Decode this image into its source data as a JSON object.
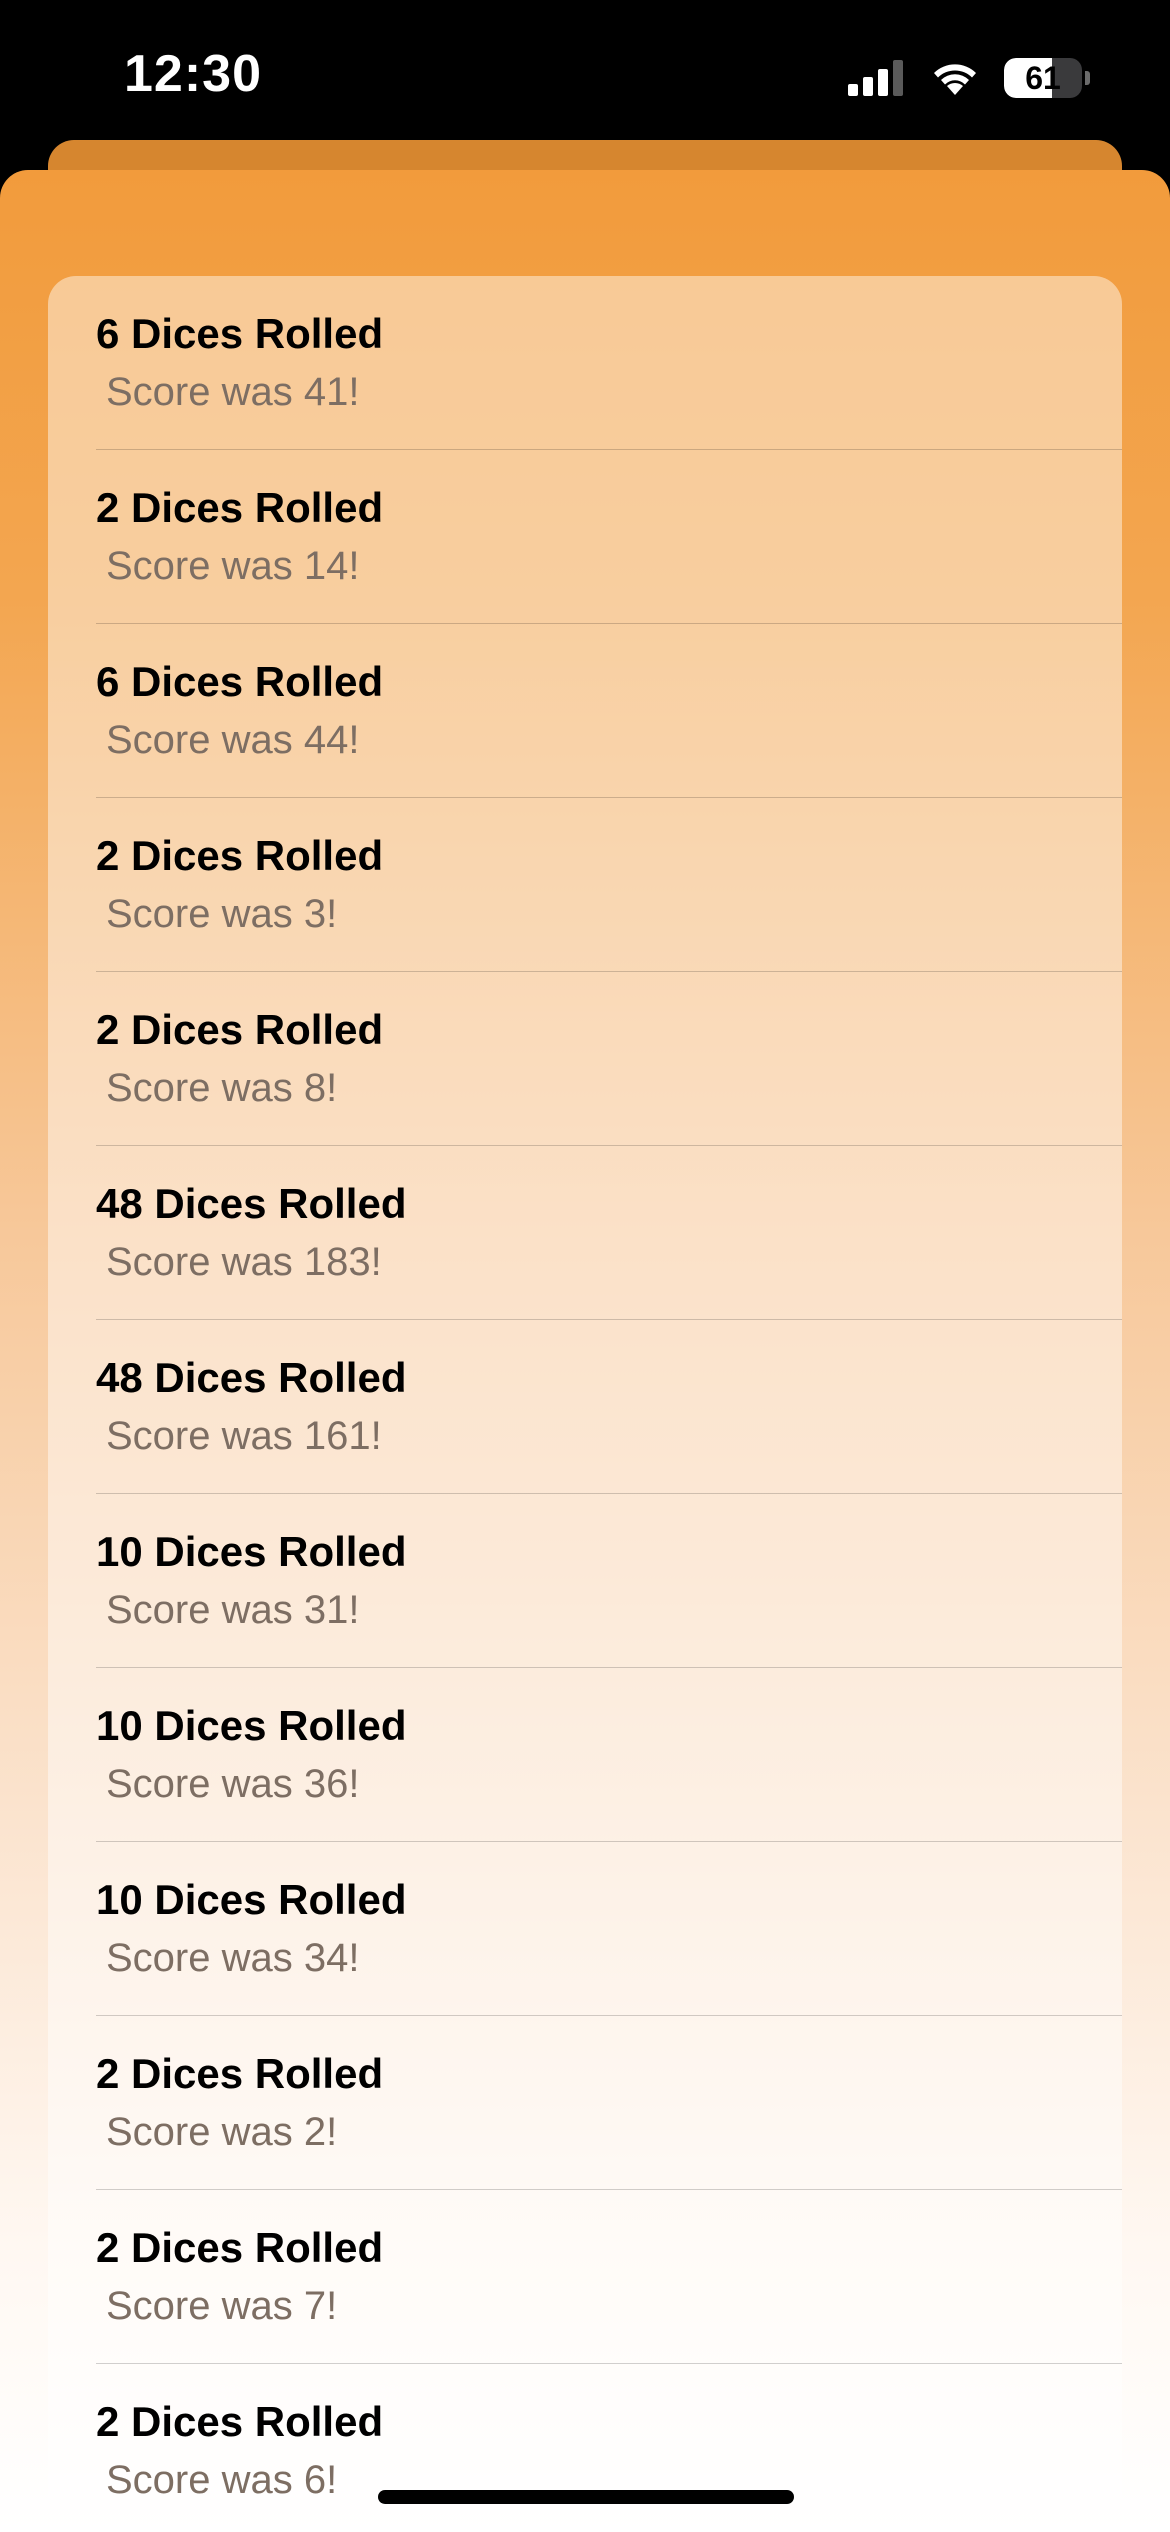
{
  "status_bar": {
    "time": "12:30",
    "battery_percent": "61",
    "battery_level": 0.61
  },
  "roll_history": [
    {
      "title": "6 Dices Rolled",
      "score": "Score was 41!"
    },
    {
      "title": "2 Dices Rolled",
      "score": "Score was 14!"
    },
    {
      "title": "6 Dices Rolled",
      "score": "Score was 44!"
    },
    {
      "title": "2 Dices Rolled",
      "score": "Score was 3!"
    },
    {
      "title": "2 Dices Rolled",
      "score": "Score was 8!"
    },
    {
      "title": "48 Dices Rolled",
      "score": "Score was 183!"
    },
    {
      "title": "48 Dices Rolled",
      "score": "Score was 161!"
    },
    {
      "title": "10 Dices Rolled",
      "score": "Score was 31!"
    },
    {
      "title": "10 Dices Rolled",
      "score": "Score was 36!"
    },
    {
      "title": "10 Dices Rolled",
      "score": "Score was 34!"
    },
    {
      "title": "2 Dices Rolled",
      "score": "Score was 2!"
    },
    {
      "title": "2 Dices Rolled",
      "score": "Score was 7!"
    },
    {
      "title": "2 Dices Rolled",
      "score": "Score was 6!"
    }
  ],
  "colors": {
    "sheet_top": "#f29b3c",
    "sheet_bottom": "#ffffff",
    "back_sheet": "#d6862f",
    "score_text": "#7d6e63"
  },
  "icons": {
    "signal": "cellular-signal-icon",
    "wifi": "wifi-icon",
    "battery": "battery-icon"
  }
}
